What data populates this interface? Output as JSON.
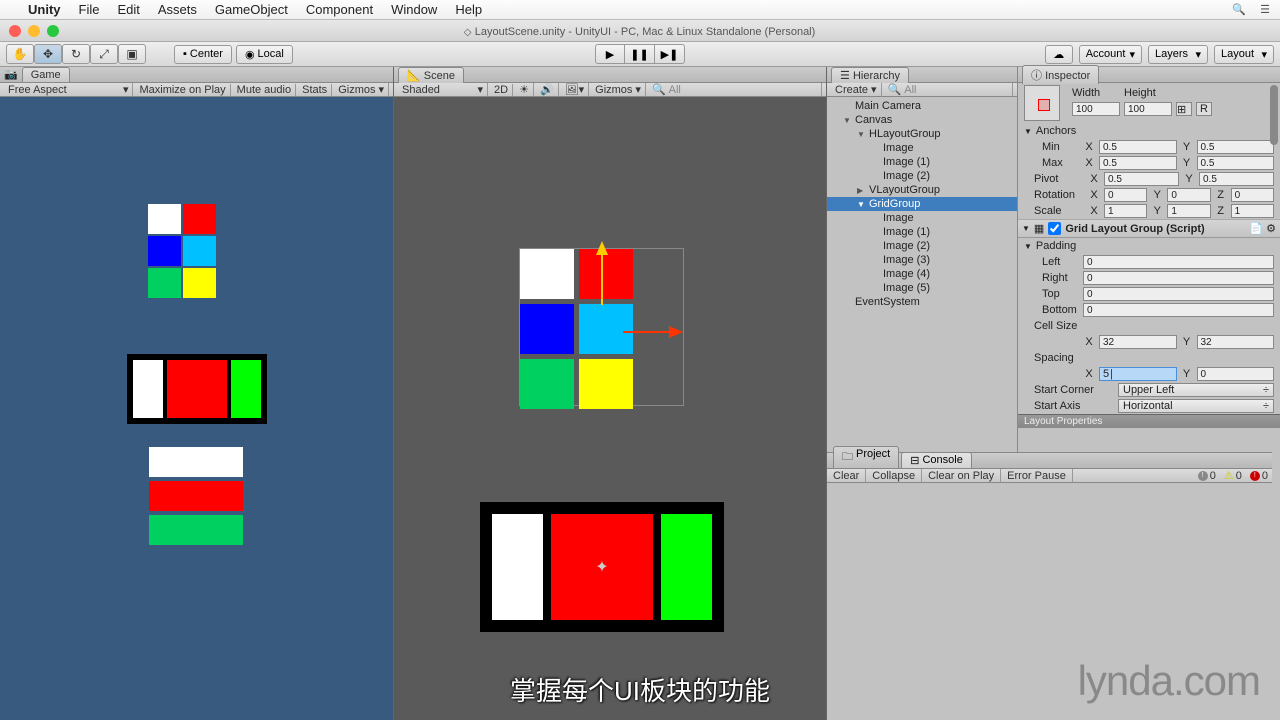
{
  "mac_menu": {
    "app": "Unity",
    "items": [
      "File",
      "Edit",
      "Assets",
      "GameObject",
      "Component",
      "Window",
      "Help"
    ]
  },
  "titlebar": "LayoutScene.unity - UnityUI - PC, Mac & Linux Standalone (Personal)",
  "toolbar": {
    "center": "Center",
    "local": "Local",
    "account": "Account",
    "layers": "Layers",
    "layout": "Layout"
  },
  "game": {
    "tab": "Game",
    "aspect": "Free Aspect",
    "maximize": "Maximize on Play",
    "mute": "Mute audio",
    "stats": "Stats",
    "gizmos": "Gizmos"
  },
  "scene": {
    "tab": "Scene",
    "shaded": "Shaded",
    "mode2d": "2D",
    "gizmos": "Gizmos",
    "search_placeholder": "All"
  },
  "hierarchy": {
    "tab": "Hierarchy",
    "create": "Create",
    "search_placeholder": "All",
    "items": [
      {
        "name": "Main Camera",
        "indent": 1
      },
      {
        "name": "Canvas",
        "indent": 1,
        "expand": "▼"
      },
      {
        "name": "HLayoutGroup",
        "indent": 2,
        "expand": "▼"
      },
      {
        "name": "Image",
        "indent": 3
      },
      {
        "name": "Image (1)",
        "indent": 3
      },
      {
        "name": "Image (2)",
        "indent": 3
      },
      {
        "name": "VLayoutGroup",
        "indent": 2,
        "expand": "▶"
      },
      {
        "name": "GridGroup",
        "indent": 2,
        "expand": "▼",
        "selected": true
      },
      {
        "name": "Image",
        "indent": 3
      },
      {
        "name": "Image (1)",
        "indent": 3
      },
      {
        "name": "Image (2)",
        "indent": 3
      },
      {
        "name": "Image (3)",
        "indent": 3
      },
      {
        "name": "Image (4)",
        "indent": 3
      },
      {
        "name": "Image (5)",
        "indent": 3
      },
      {
        "name": "EventSystem",
        "indent": 1
      }
    ]
  },
  "inspector": {
    "tab": "Inspector",
    "width_label": "Width",
    "height_label": "Height",
    "width": "100",
    "height": "100",
    "anchors": "Anchors",
    "min": "Min",
    "max": "Max",
    "min_x": "0.5",
    "min_y": "0.5",
    "max_x": "0.5",
    "max_y": "0.5",
    "pivot": "Pivot",
    "pivot_x": "0.5",
    "pivot_y": "0.5",
    "rotation": "Rotation",
    "rot_x": "0",
    "rot_y": "0",
    "rot_z": "0",
    "scale": "Scale",
    "scale_x": "1",
    "scale_y": "1",
    "scale_z": "1",
    "component": "Grid Layout Group (Script)",
    "padding": "Padding",
    "left": "Left",
    "left_v": "0",
    "right": "Right",
    "right_v": "0",
    "top": "Top",
    "top_v": "0",
    "bottom": "Bottom",
    "bottom_v": "0",
    "cellsize": "Cell Size",
    "cs_x": "32",
    "cs_y": "32",
    "spacing": "Spacing",
    "sp_x": "5",
    "sp_y": "0",
    "startcorner": "Start Corner",
    "startcorner_v": "Upper Left",
    "startaxis": "Start Axis",
    "startaxis_v": "Horizontal",
    "layoutprops": "Layout Properties"
  },
  "bottom": {
    "project": "Project",
    "console": "Console",
    "clear": "Clear",
    "collapse": "Collapse",
    "clearonplay": "Clear on Play",
    "errorpause": "Error Pause",
    "count0": "0"
  },
  "watermark": "lynda.com",
  "subtitle": "掌握每个UI板块的功能",
  "grid_colors": [
    "#ffffff",
    "#ff0000",
    "#0000ff",
    "#00c0ff",
    "#00d060",
    "#ffff00"
  ],
  "vlayout_colors": [
    "#ffffff",
    "#ff0000",
    "#00d060"
  ]
}
